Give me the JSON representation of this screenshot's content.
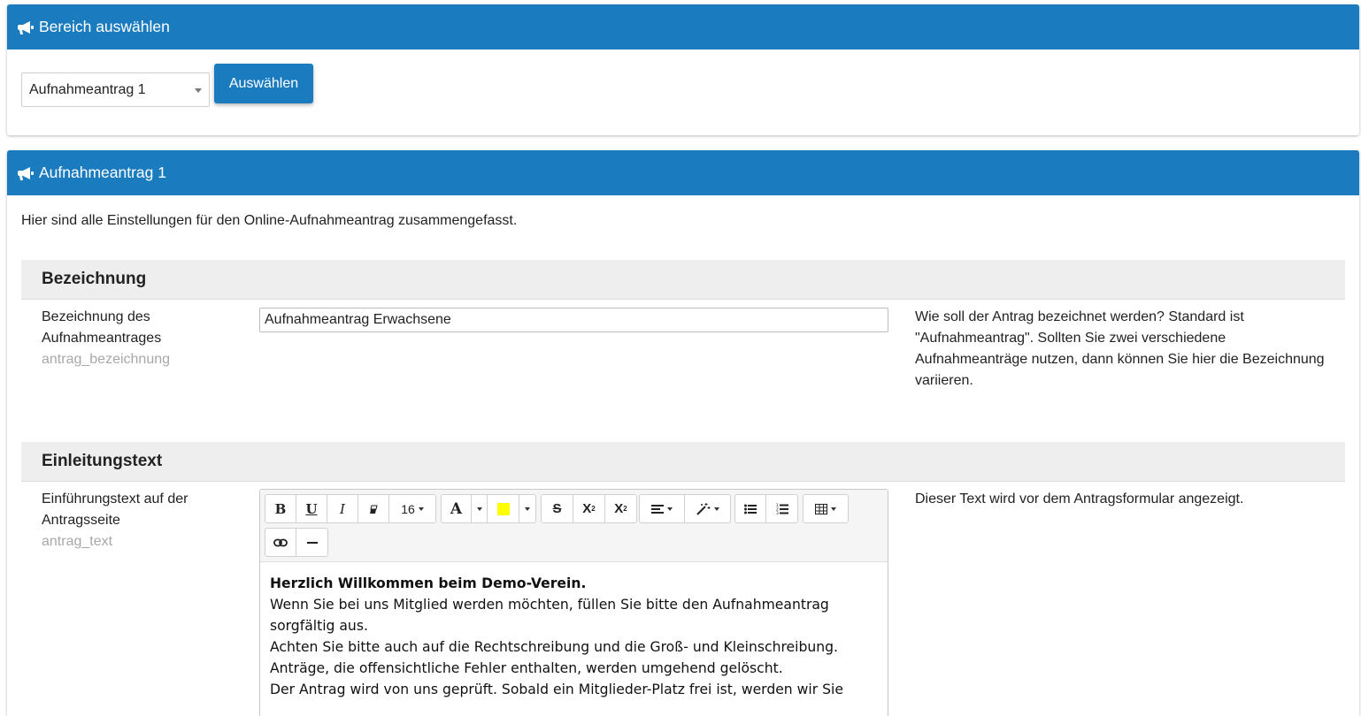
{
  "select_panel": {
    "title": "Bereich auswählen",
    "icon": "bullhorn-icon",
    "selected_value": "Aufnahmeantrag 1",
    "select_button_label": "Auswählen"
  },
  "main_panel": {
    "title": "Aufnahmeantrag 1",
    "icon": "bullhorn-icon",
    "intro": "Hier sind alle Einstellungen für den Online-Aufnahmeantrag zusammengefasst.",
    "sections": [
      {
        "heading": "Bezeichnung",
        "label_line1": "Bezeichnung des",
        "label_line2": "Aufnahmeantrages",
        "key": "antrag_bezeichnung",
        "value": "Aufnahmeantrag Erwachsene",
        "help_line1": "Wie soll der Antrag bezeichnet werden? Standard ist",
        "help_line2": "\"Aufnahmeantrag\". Sollten Sie zwei verschiedene",
        "help_line3": "Aufnahmeanträge nutzen, dann können Sie hier die Bezeichnung",
        "help_line4": "variieren."
      },
      {
        "heading": "Einleitungstext",
        "label_line1": "Einführungstext auf der",
        "label_line2": "Antragsseite",
        "key": "antrag_text",
        "help": "Dieser Text wird vor dem Antragsformular angezeigt.",
        "editor": {
          "font_size": "16",
          "highlight_color": "#ffff00",
          "content_heading": "Herzlich Willkommen beim Demo-Verein.",
          "content_lines": [
            "Wenn Sie bei uns Mitglied werden möchten, füllen Sie bitte den Aufnahmeantrag",
            "sorgfältig aus.",
            "Achten Sie bitte auch auf die Rechtschreibung und die Groß- und Kleinschreibung.",
            "Anträge, die offensichtliche Fehler enthalten, werden umgehend gelöscht.",
            "Der Antrag wird von uns geprüft. Sobald ein Mitglieder-Platz frei ist, werden wir Sie"
          ]
        }
      }
    ]
  },
  "colors": {
    "header_blue": "#1a7bbf",
    "section_gray": "#eeeeee",
    "key_gray": "#a8a8a8"
  }
}
